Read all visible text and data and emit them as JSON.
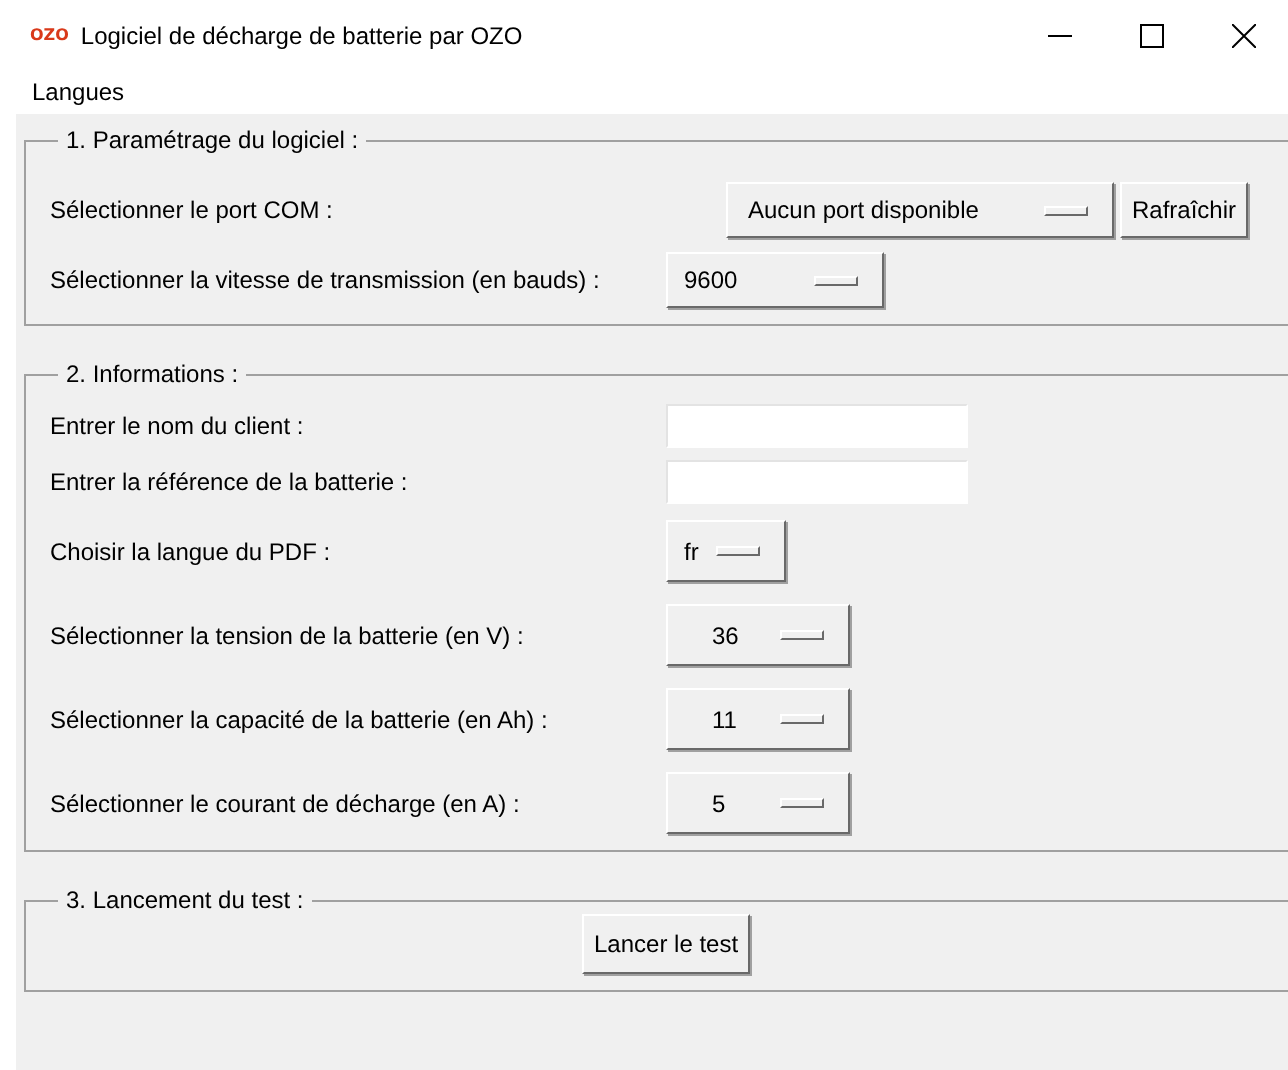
{
  "window": {
    "title": "Logiciel de décharge de batterie par OZO",
    "icon_text": "OZO"
  },
  "menu": [
    "Langues"
  ],
  "sections": [
    {
      "title": "1. Paramétrage du logiciel :",
      "rows": [
        {
          "kind": "option_button",
          "label": "Sélectionner le port COM :",
          "value": "Aucun port disponible",
          "button": "Rafraîchir"
        },
        {
          "kind": "option",
          "label": "Sélectionner la vitesse de transmission (en bauds) :",
          "value": "9600"
        }
      ]
    },
    {
      "title": "2. Informations :",
      "rows": [
        {
          "kind": "entry",
          "label": "Entrer le nom du client :"
        },
        {
          "kind": "entry",
          "label": "Entrer la référence de la batterie :"
        },
        {
          "kind": "option_small",
          "label": "Choisir la langue du PDF :",
          "value": "fr"
        },
        {
          "kind": "option_num",
          "label": "Sélectionner la tension de la batterie (en V) :",
          "value": "36"
        },
        {
          "kind": "option_num",
          "label": "Sélectionner la capacité de la batterie (en Ah) :",
          "value": "11"
        },
        {
          "kind": "option_num",
          "label": "Sélectionner le courant de décharge (en A) :",
          "value": "5"
        }
      ]
    },
    {
      "title": "3. Lancement du test :",
      "rows": [
        {
          "kind": "button",
          "button": "Lancer le test"
        }
      ]
    }
  ]
}
